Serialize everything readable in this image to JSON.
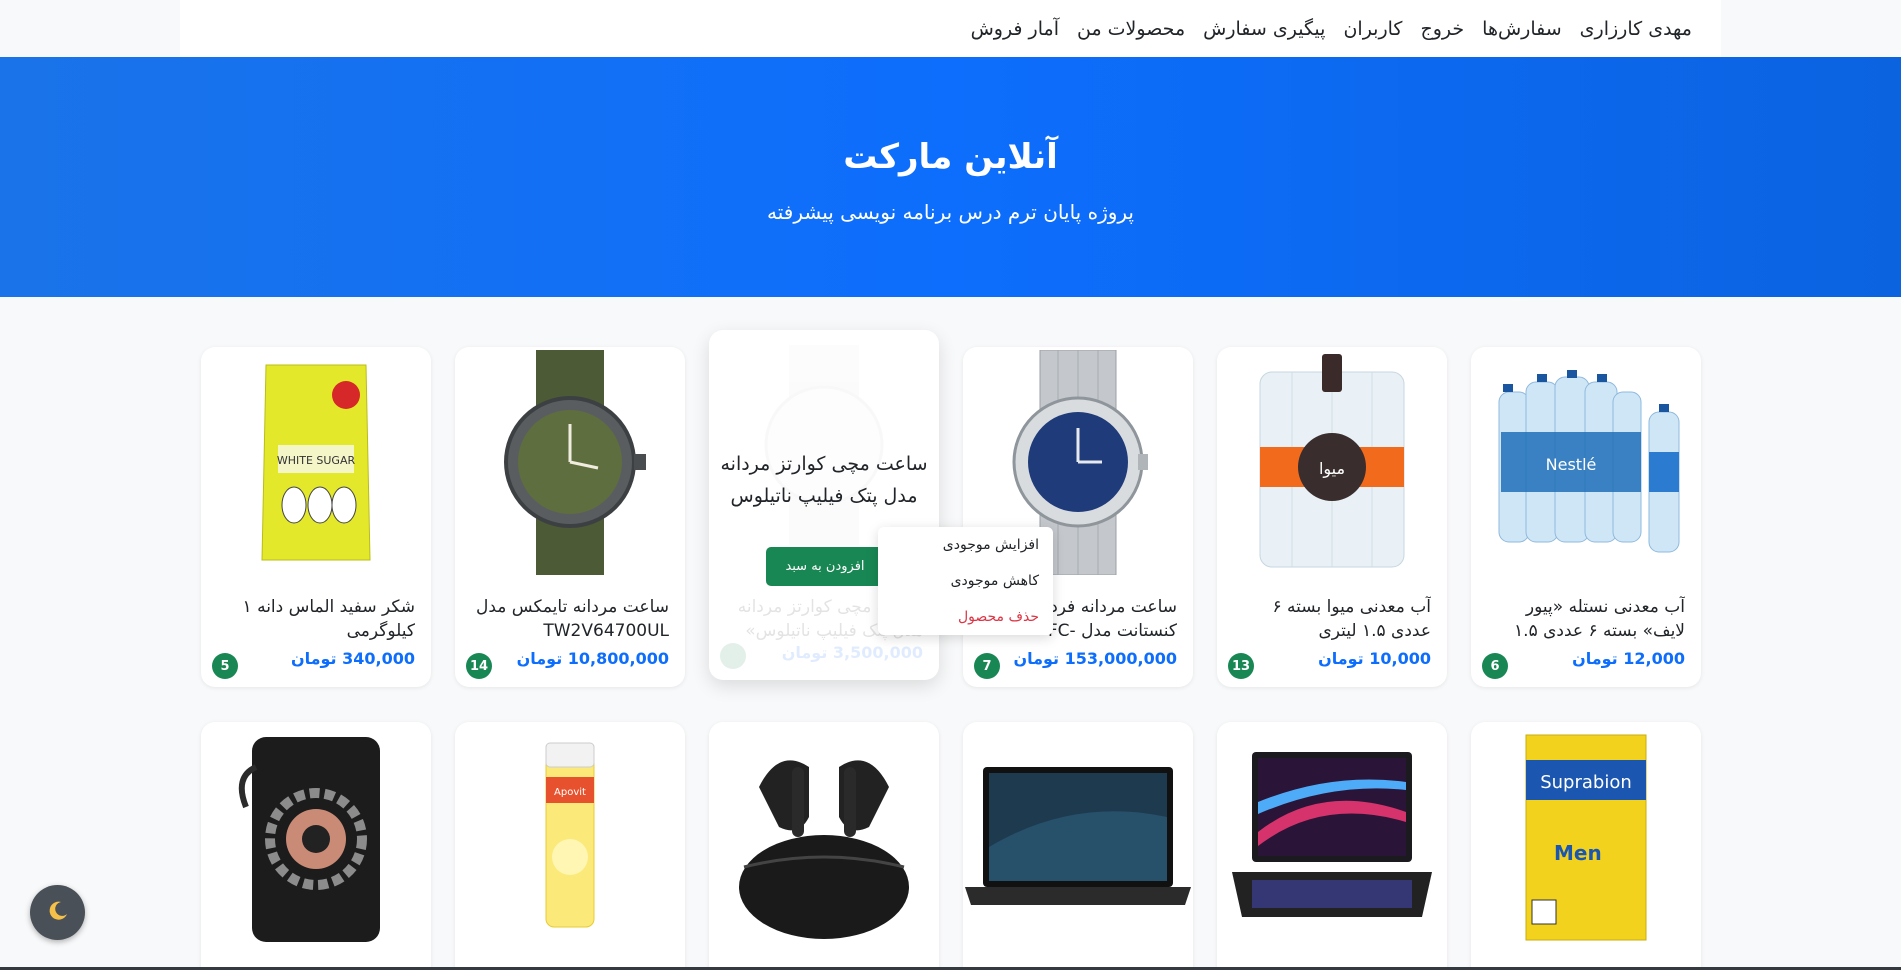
{
  "nav": {
    "items": [
      "مهدی کارزاری",
      "سفارش‌ها",
      "خروج",
      "کاربران",
      "پیگیری سفارش",
      "محصولات من",
      "آمار فروش"
    ]
  },
  "hero": {
    "title": "آنلاین مارکت",
    "subtitle": "پروژه پایان ترم درس برنامه نویسی پیشرفته"
  },
  "products_row1": [
    {
      "title": "آب معدنی نستله «پیور لایف» بسته ۶ عددی ۱.۵",
      "price": "12,000 تومان",
      "stock": "6",
      "image": "water-pack-image"
    },
    {
      "title": "آب معدنی میوا بسته ۶ عددی ۱.۵ لیتری",
      "price": "10,000 تومان",
      "stock": "13",
      "image": "water-bottles-image"
    },
    {
      "title": "ساعت مردانه فردریک کنستانت مدل -FC",
      "price": "153,000,000 تومان",
      "stock": "7",
      "image": "steel-watch-image"
    },
    {
      "title": "ساعت مچی کوارتز مردانه مدل پتک فیلیپ ناتیلوس",
      "price": "3,500,000 تومان",
      "stock": "",
      "image": "white-watch-image"
    },
    {
      "title": "ساعت مردانه تایمکس مدل TW2V64700UL",
      "price": "10,800,000 تومان",
      "stock": "14",
      "image": "green-watch-image"
    },
    {
      "title": "شکر سفید الماس دانه ۱ کیلوگرمی",
      "price": "340,000 تومان",
      "stock": "5",
      "image": "sugar-pack-image"
    }
  ],
  "hover_card": {
    "title": "ساعت مچی کوارتز مردانه مدل پتک فیلیپ ناتیلوس",
    "add_to_cart": "افزودن به سبد",
    "faded_title": "ساعت مچی کوارتز مردانه مدل پتک فیلیپ ناتیلوس» مدل"
  },
  "context_menu": {
    "increase": "افزایش موجودی",
    "decrease": "کاهش موجودی",
    "delete": "حذف محصول"
  },
  "products_row2": [
    {
      "image": "supplement-box-image"
    },
    {
      "image": "gaming-laptop-image"
    },
    {
      "image": "laptop-image"
    },
    {
      "image": "earbuds-image"
    },
    {
      "image": "vitamin-tube-image"
    },
    {
      "image": "powerbank-image"
    }
  ],
  "theme_toggle": {
    "icon": "moon-icon"
  },
  "colors": {
    "primary": "#0d6efd",
    "success": "#198754",
    "danger": "#dc3545"
  }
}
